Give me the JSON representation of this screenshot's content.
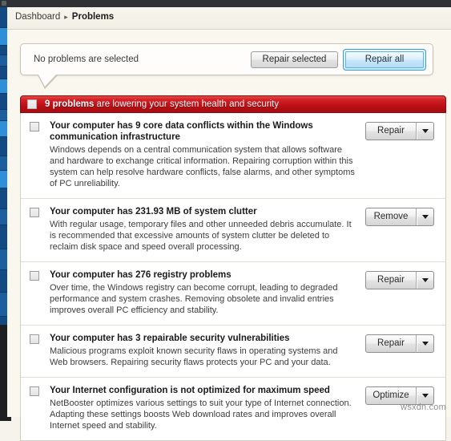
{
  "window": {
    "title_bar_color": "#2e3234",
    "sidebar_color": "#134a81",
    "sidebar_accent_color": "#2f8fd8"
  },
  "breadcrumb": {
    "root_label": "Dashboard",
    "separator": "▸",
    "current_label": "Problems"
  },
  "callout": {
    "message": "No problems are selected",
    "repair_selected_label": "Repair selected",
    "repair_all_label": "Repair all",
    "accent_color": "#3e9ad4"
  },
  "banner": {
    "count_text": "9 problems",
    "rest_text": " are lowering your system health and security",
    "color_start": "#e94a44",
    "color_end": "#a50c12"
  },
  "problems": [
    {
      "title": "Your computer has 9 core data conflicts within the Windows communication infrastructure",
      "description": "Windows depends on a central communication system that allows software and hardware to exchange critical information. Repairing corruption within this system can help resolve hardware conflicts, false alarms, and other symptoms of PC unreliability.",
      "action_label": "Repair"
    },
    {
      "title": "Your computer has 231.93 MB of system clutter",
      "description": "With regular usage, temporary files and other unneeded debris accumulate. It is recommended that excessive amounts of system clutter be deleted to reclaim disk space and speed overall processing.",
      "action_label": "Remove"
    },
    {
      "title": "Your computer has 276 registry problems",
      "description": "Over time, the Windows registry can become corrupt, leading to degraded performance and system crashes. Removing obsolete and invalid entries improves overall PC efficiency and stability.",
      "action_label": "Repair"
    },
    {
      "title": "Your computer has 3 repairable security vulnerabilities",
      "description": "Malicious programs exploit known security flaws in operating systems and Web browsers. Repairing security flaws protects your PC and your data.",
      "action_label": "Repair"
    },
    {
      "title": "Your Internet configuration is not optimized for maximum speed",
      "description": "NetBooster optimizes various settings to suit your type of Internet connection. Adapting these settings boosts Web download rates and improves overall Internet speed and stability.",
      "action_label": "Optimize"
    }
  ],
  "watermark": {
    "text": "wsxdn.com"
  }
}
